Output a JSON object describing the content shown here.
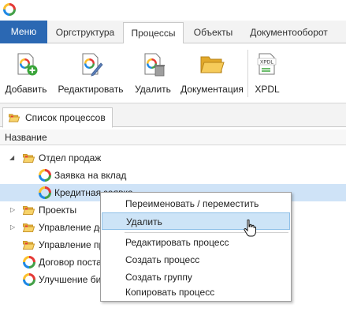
{
  "menu": {
    "main_label": "Меню",
    "tabs": [
      {
        "label": "Оргструктура"
      },
      {
        "label": "Процессы"
      },
      {
        "label": "Объекты"
      },
      {
        "label": "Документооборот"
      }
    ]
  },
  "ribbon": {
    "add_label": "Добавить",
    "edit_label": "Редактировать",
    "delete_label": "Удалить",
    "docs_label": "Документация",
    "xpdl_label": "XPDL",
    "xpdl_icon_text": "XPDL"
  },
  "doc_tab": {
    "label": "Список процессов"
  },
  "column": {
    "name_header": "Название"
  },
  "tree": {
    "rows": [
      {
        "label": "Отдел продаж"
      },
      {
        "label": "Заявка на вклад"
      },
      {
        "label": "Кредитная заявка"
      },
      {
        "label": "Проекты"
      },
      {
        "label": "Управление до"
      },
      {
        "label": "Управление пр"
      },
      {
        "label": "Договор поста"
      },
      {
        "label": "Улучшение би"
      }
    ]
  },
  "context_menu": {
    "items": [
      {
        "label": "Переименовать / переместить"
      },
      {
        "label": "Удалить"
      },
      {
        "label": "Редактировать процесс"
      },
      {
        "label": "Создать процесс"
      },
      {
        "label": "Создать группу"
      },
      {
        "label": "Копировать процесс"
      }
    ]
  },
  "colors": {
    "menu_blue": "#2b68b3",
    "selection": "#cfe3f7",
    "hover": "#cde4f7",
    "folder": "#f2c040"
  }
}
